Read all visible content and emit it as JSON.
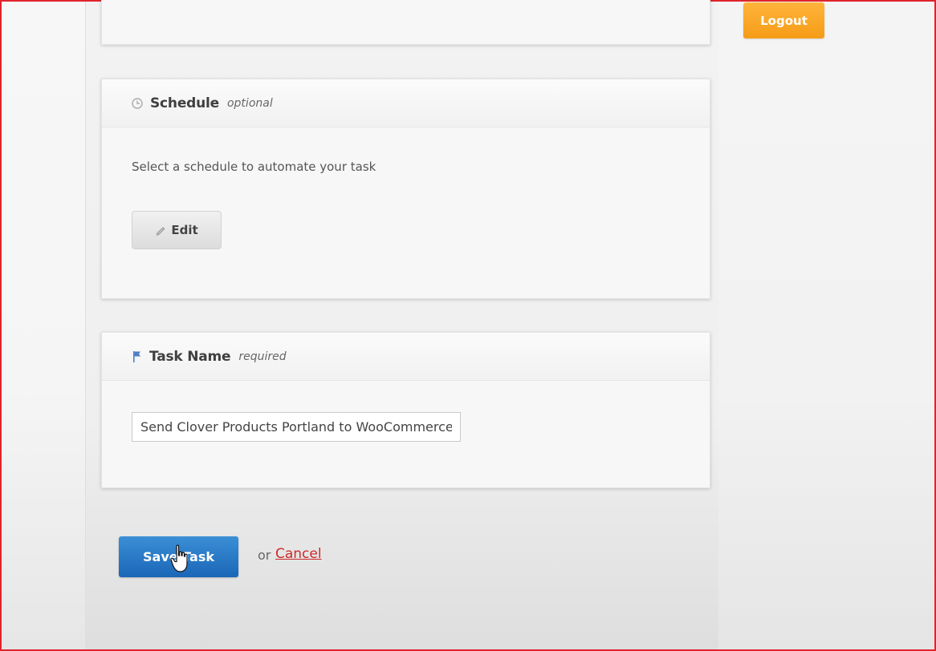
{
  "header": {
    "logout_label": "Logout"
  },
  "schedule_panel": {
    "title": "Schedule",
    "subtitle": "optional",
    "description": "Select a schedule to automate your task",
    "edit_label": "Edit"
  },
  "task_name_panel": {
    "title": "Task Name",
    "subtitle": "required",
    "value": "Send Clover Products Portland to WooCommerce"
  },
  "actions": {
    "save_label": "Save Task",
    "or_text": "or",
    "cancel_label": "Cancel"
  },
  "colors": {
    "accent_orange": "#f5a21a",
    "primary_blue": "#2a77c9",
    "cancel_red": "#cc2b2b",
    "border_red": "#e0242c"
  },
  "icons": {
    "schedule": "clock-icon",
    "task_name": "flag-icon",
    "edit": "pencil-icon",
    "cursor": "hand-cursor-icon"
  }
}
